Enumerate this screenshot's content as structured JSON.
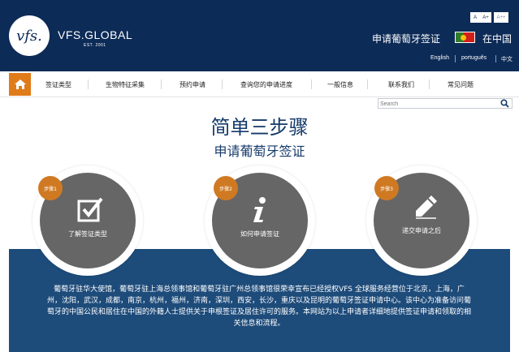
{
  "header": {
    "logo_mark": "vfs.",
    "brand": "VFS.GLOBAL",
    "brand_sub": "EST. 2001",
    "font_controls": [
      "A",
      "A+",
      "A++"
    ],
    "title": "申请葡萄牙签证",
    "location": "在中国",
    "languages": [
      "English",
      "português",
      "中文"
    ],
    "colors": {
      "navy": "#0d2b57",
      "accent": "#e07b1a"
    }
  },
  "nav": {
    "home_icon": "home-icon",
    "items": [
      "签证类型",
      "生物特征采集",
      "预约申请",
      "查询您的申请进度",
      "一般信息",
      "联系我们",
      "常见问题"
    ]
  },
  "search": {
    "placeholder": "Search"
  },
  "hero": {
    "title": "简单三步骤",
    "subtitle": "申请葡萄牙签证"
  },
  "steps": [
    {
      "badge": "步骤1",
      "label": "了解签证类型",
      "icon": "checkbox-check-icon"
    },
    {
      "badge": "步骤2",
      "label": "如何申请签证",
      "icon": "info-icon"
    },
    {
      "badge": "步骤3",
      "label": "递交申请之后",
      "icon": "pen-icon"
    }
  ],
  "description": "葡萄牙驻华大使馆，葡萄牙驻上海总领事馆和葡萄牙驻广州总领事馆很荣幸宣布已经授权VFS 全球服务经营位于北京，上海，广州，沈阳，武汉，成都，南京，杭州，福州，济南，深圳，西安，长沙，重庆以及昆明的葡萄牙签证申请中心。该中心为准备访问葡萄牙的中国公民和居住在中国的外籍人士提供关于申根签证及居住许可的服务。本网站为以上申请者详细地提供签证申请和领取的相关信息和流程。"
}
